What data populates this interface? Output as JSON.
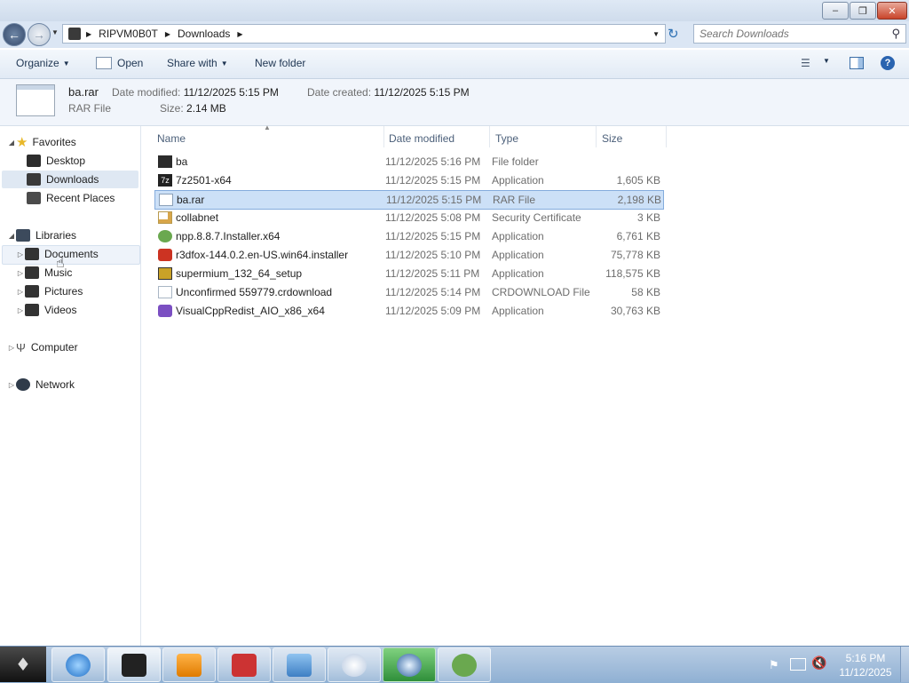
{
  "window": {
    "title_buttons": {
      "minimize": "‒",
      "maximize": "❐",
      "close": "✕"
    }
  },
  "address": {
    "segments": [
      "RIPVM0B0T",
      "Downloads"
    ],
    "search_placeholder": "Search Downloads"
  },
  "toolbar": {
    "organize": "Organize",
    "open": "Open",
    "share_with": "Share with",
    "new_folder": "New folder"
  },
  "details": {
    "filename": "ba.rar",
    "filetype": "RAR File",
    "date_modified_label": "Date modified:",
    "date_modified_value": "11/12/2025 5:15 PM",
    "date_created_label": "Date created:",
    "date_created_value": "11/12/2025 5:15 PM",
    "size_label": "Size:",
    "size_value": "2.14 MB"
  },
  "nav": {
    "favorites": "Favorites",
    "desktop": "Desktop",
    "downloads": "Downloads",
    "recent_places": "Recent Places",
    "libraries": "Libraries",
    "documents": "Documents",
    "music": "Music",
    "pictures": "Pictures",
    "videos": "Videos",
    "computer": "Computer",
    "network": "Network"
  },
  "columns": {
    "name": "Name",
    "date_modified": "Date modified",
    "type": "Type",
    "size": "Size"
  },
  "files": [
    {
      "name": "ba",
      "date": "11/12/2025 5:16 PM",
      "type": "File folder",
      "size": "",
      "icon": "folder-icon",
      "color": "#2b2b2b"
    },
    {
      "name": "7z2501-x64",
      "date": "11/12/2025 5:15 PM",
      "type": "Application",
      "size": "1,605 KB",
      "icon": "7zip-icon",
      "color": "#222222"
    },
    {
      "name": "ba.rar",
      "date": "11/12/2025 5:15 PM",
      "type": "RAR File",
      "size": "2,198 KB",
      "icon": "file-icon",
      "color": "#ffffff"
    },
    {
      "name": "collabnet",
      "date": "11/12/2025 5:08 PM",
      "type": "Security Certificate",
      "size": "3 KB",
      "icon": "certificate-icon",
      "color": "#d8a64a"
    },
    {
      "name": "npp.8.8.7.Installer.x64",
      "date": "11/12/2025 5:15 PM",
      "type": "Application",
      "size": "6,761 KB",
      "icon": "notepadpp-icon",
      "color": "#6aa84f"
    },
    {
      "name": "r3dfox-144.0.2.en-US.win64.installer",
      "date": "11/12/2025 5:10 PM",
      "type": "Application",
      "size": "75,778 KB",
      "icon": "r3dfox-icon",
      "color": "#cc3322"
    },
    {
      "name": "supermium_132_64_setup",
      "date": "11/12/2025 5:11 PM",
      "type": "Application",
      "size": "118,575 KB",
      "icon": "installer-icon",
      "color": "#c9a227"
    },
    {
      "name": "Unconfirmed 559779.crdownload",
      "date": "11/12/2025 5:14 PM",
      "type": "CRDOWNLOAD File",
      "size": "58 KB",
      "icon": "file-icon",
      "color": "#ffffff"
    },
    {
      "name": "VisualCppRedist_AIO_x86_x64",
      "date": "11/12/2025 5:09 PM",
      "type": "Application",
      "size": "30,763 KB",
      "icon": "visualstudio-icon",
      "color": "#7b4fc2"
    }
  ],
  "taskbar": {
    "clock_time": "5:16 PM",
    "clock_date": "11/12/2025"
  },
  "colors": {
    "selection": "#cce0f7",
    "nav_selected": "#dfe8f3"
  }
}
